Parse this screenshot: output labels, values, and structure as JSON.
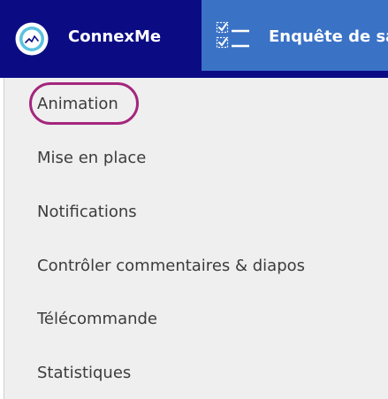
{
  "topbar": {
    "brand": {
      "name": "ConnexMe",
      "logo_icon": "connexme-logo-icon"
    },
    "survey_tab": {
      "label": "Enquête de sa",
      "icon": "checklist-icon"
    }
  },
  "menu": {
    "items": [
      {
        "label": "Animation",
        "highlighted": true
      },
      {
        "label": "Mise en place"
      },
      {
        "label": "Notifications"
      },
      {
        "label": "Contrôler commentaires & diapos"
      },
      {
        "label": "Télécommande"
      },
      {
        "label": "Statistiques"
      }
    ]
  },
  "colors": {
    "topbar_bg": "#0b0c84",
    "survey_tab_bg": "#3a72c6",
    "menu_bg": "#efefef",
    "menu_text": "#3c3c3c",
    "highlight_ring": "#a4267d"
  }
}
